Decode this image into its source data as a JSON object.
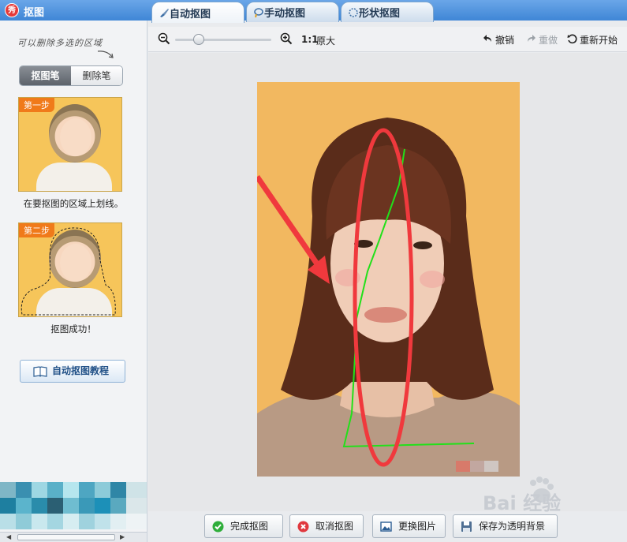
{
  "app": {
    "title": "抠图",
    "logo_glyph": "秀"
  },
  "tabs": [
    {
      "label": "自动抠图",
      "active": true
    },
    {
      "label": "手动抠图",
      "active": false
    },
    {
      "label": "形状抠图",
      "active": false
    }
  ],
  "sidebar": {
    "hint": "可以删除多选的区域",
    "segment": {
      "pen": "抠图笔",
      "eraser": "删除笔"
    },
    "step1": {
      "tag": "第一步",
      "caption": "在要抠图的区域上划线。"
    },
    "step2": {
      "tag": "第二步",
      "caption": "抠图成功！"
    },
    "tutorial_label": "自动抠图教程"
  },
  "toolbar": {
    "ratio": "1:1",
    "original_size": "原大",
    "undo": "撤销",
    "redo": "重做",
    "restart": "重新开始",
    "zoom_level": 0.2
  },
  "bottom": {
    "done": "完成抠图",
    "cancel": "取消抠图",
    "replace": "更换图片",
    "save_transparent": "保存为透明背景"
  },
  "watermark": "Bai 经验",
  "colors": {
    "accent": "#3f86d6",
    "annotation_red": "#f0393d",
    "stroke_green": "#22e01a"
  }
}
